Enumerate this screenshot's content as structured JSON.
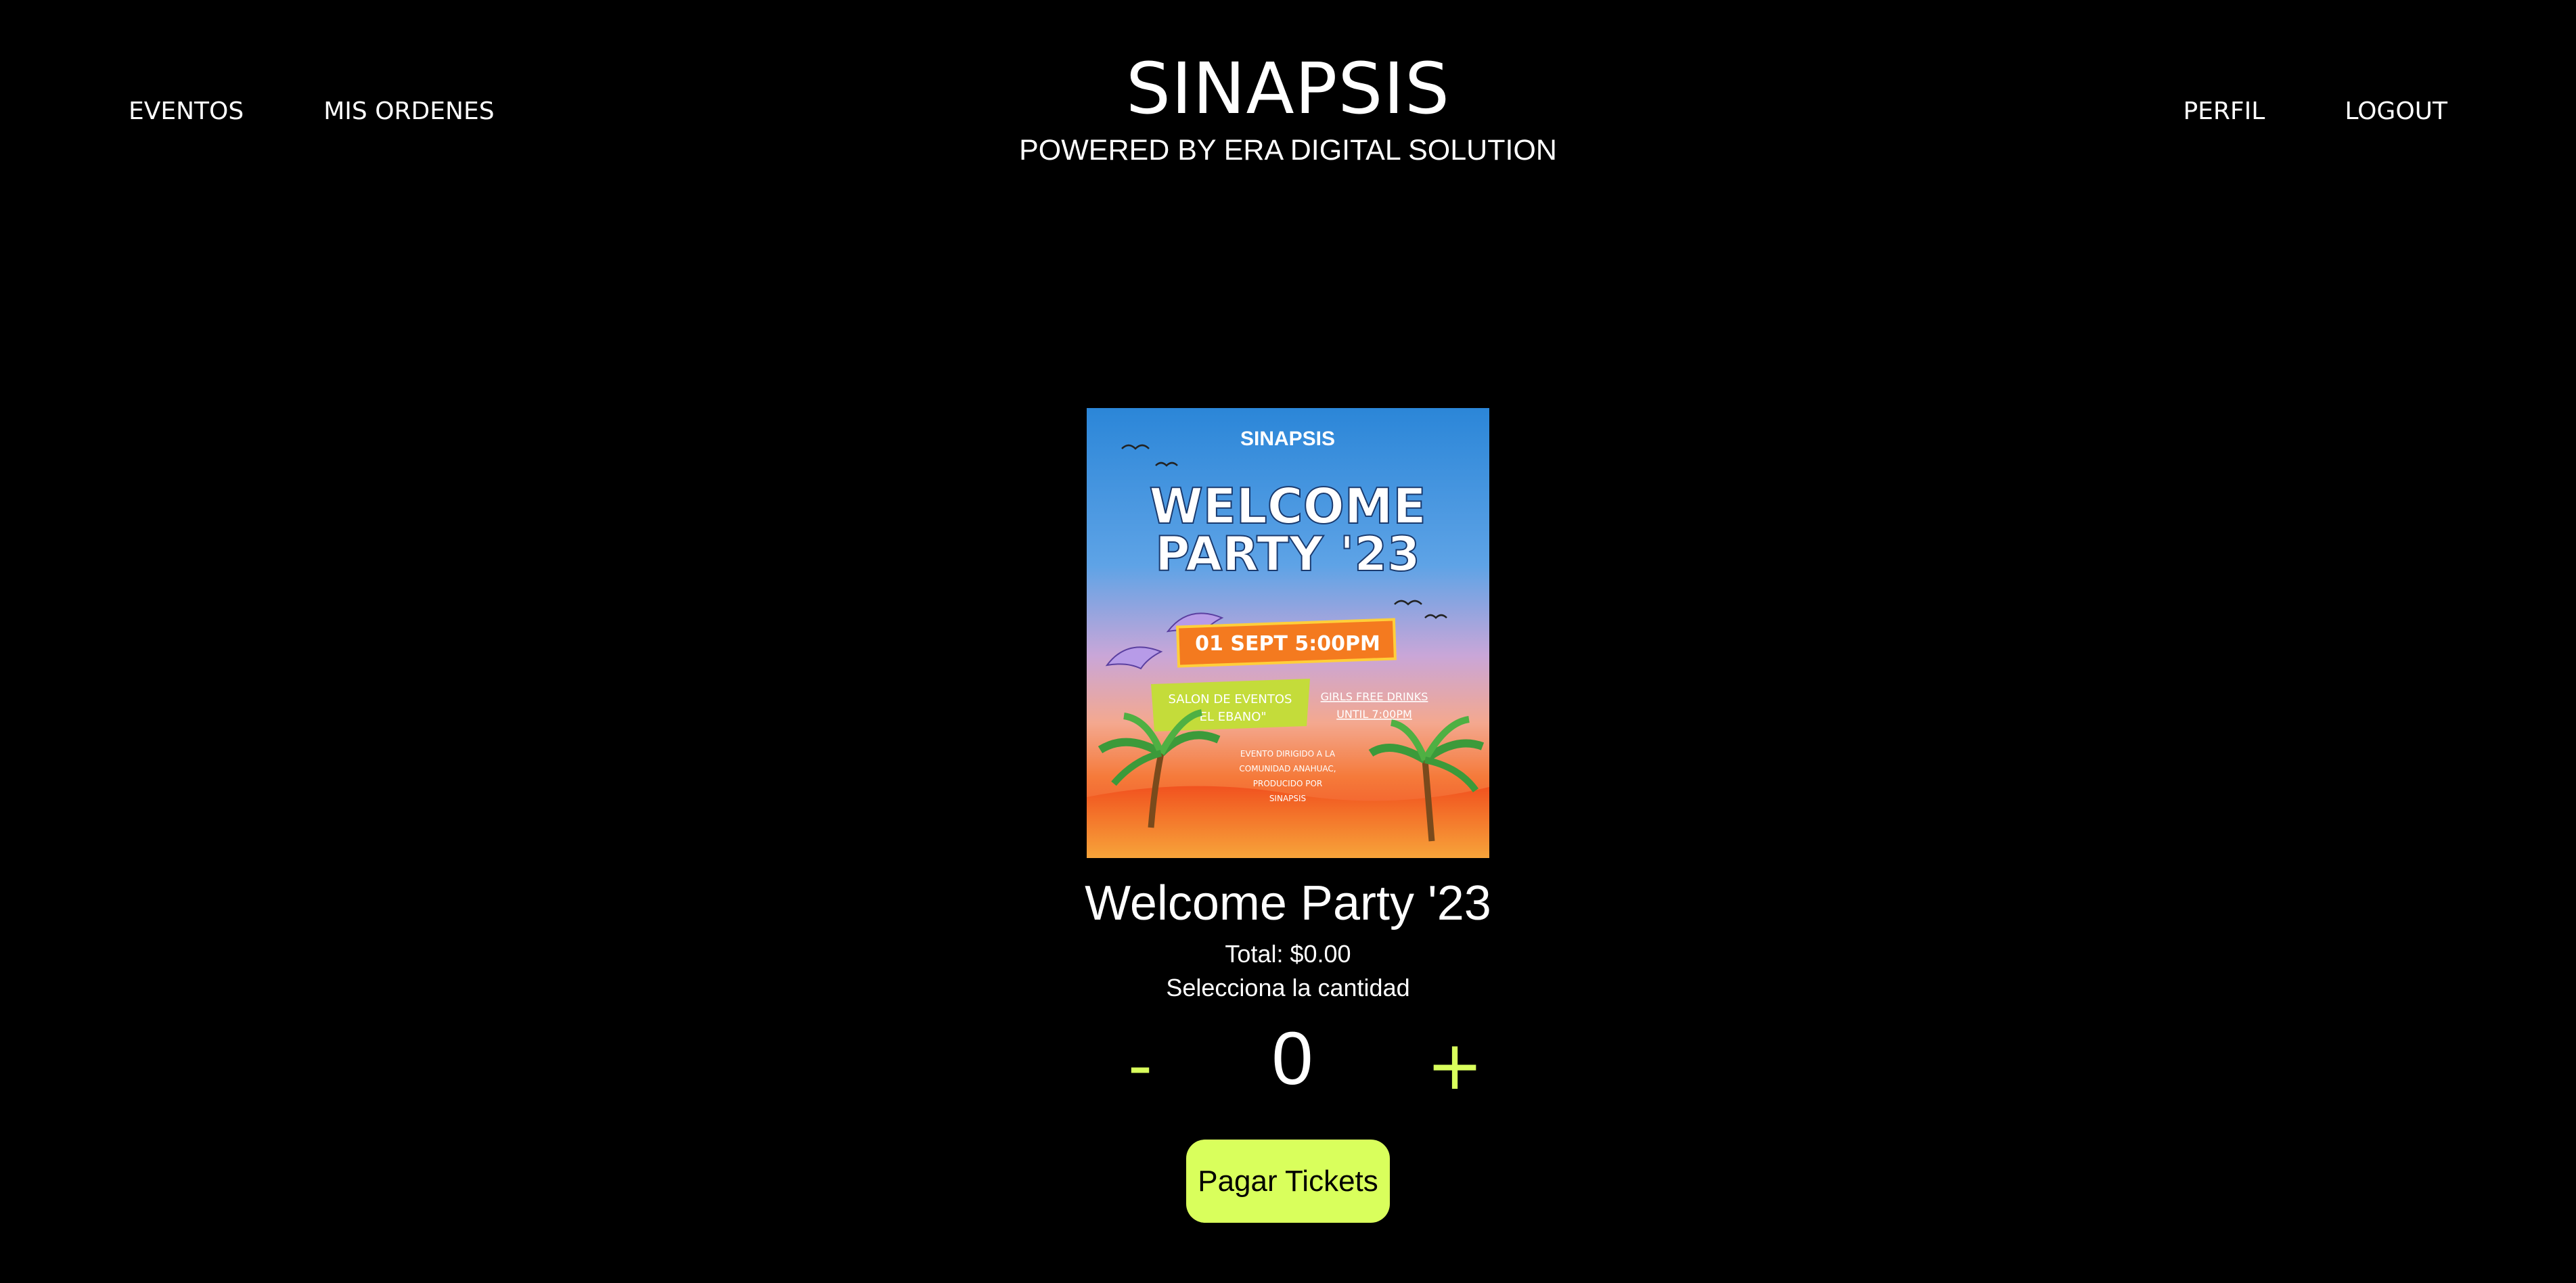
{
  "header": {
    "nav_left": [
      {
        "label": "EVENTOS"
      },
      {
        "label": "MIS ORDENES"
      }
    ],
    "nav_right": [
      {
        "label": "PERFIL"
      },
      {
        "label": "LOGOUT"
      }
    ],
    "brand_title": "SINAPSIS",
    "brand_subtitle": "POWERED BY ERA DIGITAL SOLUTION"
  },
  "event": {
    "poster": {
      "brand": "SINAPSIS",
      "headline_line1": "WELCOME",
      "headline_line2": "PARTY '23",
      "date_banner": "01 SEPT 5:00PM",
      "venue_line1": "SALON DE EVENTOS",
      "venue_line2": "\"EL EBANO\"",
      "drinks_line1": "GIRLS FREE DRINKS",
      "drinks_line2": "UNTIL 7:00PM",
      "footer_lines": [
        "EVENTO DIRIGIDO A LA",
        "COMUNIDAD ANAHUAC,",
        "PRODUCIDO POR",
        "SINAPSIS"
      ]
    },
    "title": "Welcome Party '23",
    "total_text": "Total: $0.00",
    "select_label": "Selecciona la cantidad",
    "quantity": "0",
    "minus_label": "-",
    "plus_label": "+",
    "pay_label": "Pagar Tickets"
  },
  "colors": {
    "accent": "#d9ff5c",
    "background": "#000000",
    "text": "#ffffff"
  }
}
